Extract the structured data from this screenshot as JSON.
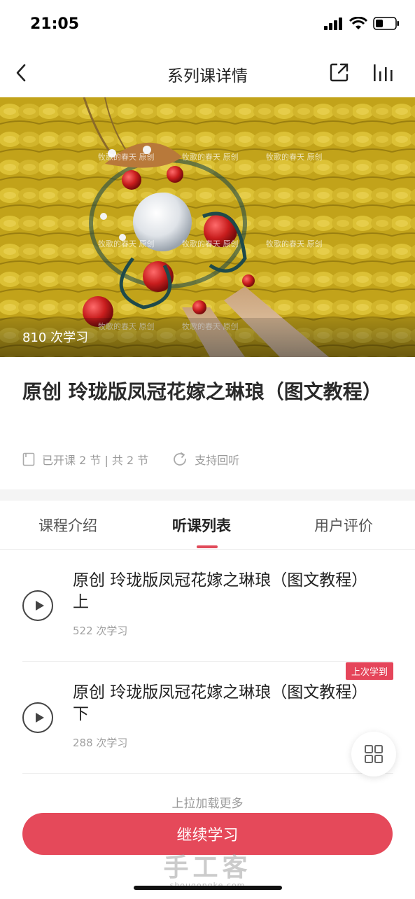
{
  "status": {
    "time": "21:05"
  },
  "nav": {
    "title": "系列课详情"
  },
  "hero": {
    "study_count": "810 次学习",
    "watermark_text": "牧歌的春天 原创"
  },
  "course": {
    "title": "原创 玲珑版凤冠花嫁之琳琅（图文教程）",
    "sessions": "已开课 2 节 | 共 2 节",
    "replay": "支持回听"
  },
  "tabs": [
    {
      "label": "课程介绍",
      "active": false
    },
    {
      "label": "听课列表",
      "active": true
    },
    {
      "label": "用户评价",
      "active": false
    }
  ],
  "lessons": [
    {
      "title": "原创 玲珑版凤冠花嫁之琳琅（图文教程）上",
      "count": "522 次学习",
      "badge": ""
    },
    {
      "title": "原创 玲珑版凤冠花嫁之琳琅（图文教程）下",
      "count": "288 次学习",
      "badge": "上次学到"
    }
  ],
  "footer": {
    "load_more": "上拉加载更多",
    "continue_label": "继续学习",
    "watermark": "手工客",
    "watermark_sub": "shougongke.com"
  },
  "colors": {
    "accent": "#e5495a",
    "hero_yellow": "#c9ab1e"
  }
}
